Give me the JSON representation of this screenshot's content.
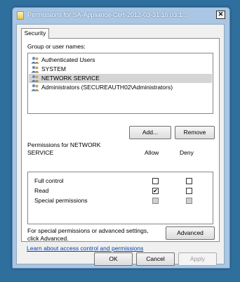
{
  "window": {
    "title": "Permissions for SA-Appliance-Cert-2012-03-31 16:03:1...",
    "close_glyph": "✕"
  },
  "tab": {
    "label": "Security"
  },
  "group_section": {
    "label": "Group or user names:",
    "items": [
      {
        "label": "Authenticated Users",
        "icon": "users-icon",
        "selected": false
      },
      {
        "label": "SYSTEM",
        "icon": "users-icon",
        "selected": false
      },
      {
        "label": "NETWORK SERVICE",
        "icon": "users-icon",
        "selected": true
      },
      {
        "label": "Administrators (SECUREAUTH02\\Administrators)",
        "icon": "users-icon",
        "selected": false
      }
    ]
  },
  "buttons": {
    "add": "Add...",
    "remove": "Remove",
    "advanced": "Advanced",
    "ok": "OK",
    "cancel": "Cancel",
    "apply": "Apply"
  },
  "permissions": {
    "header_line1": "Permissions for NETWORK",
    "header_line2": "SERVICE",
    "allow_header": "Allow",
    "deny_header": "Deny",
    "rows": [
      {
        "name": "Full control",
        "allow": false,
        "deny": false,
        "special": false
      },
      {
        "name": "Read",
        "allow": true,
        "deny": false,
        "special": false
      },
      {
        "name": "Special permissions",
        "allow": false,
        "deny": false,
        "special": true
      }
    ]
  },
  "special_note": {
    "line1": "For special permissions or advanced settings,",
    "line2": "click Advanced."
  },
  "learn_link": "Learn about access control and permissions",
  "check_glyph": "✔",
  "colors": {
    "desktop": "#2e6f9e",
    "window_frame": "#a9c6e4",
    "link": "#0645ad",
    "selection": "#d5d5d5"
  }
}
